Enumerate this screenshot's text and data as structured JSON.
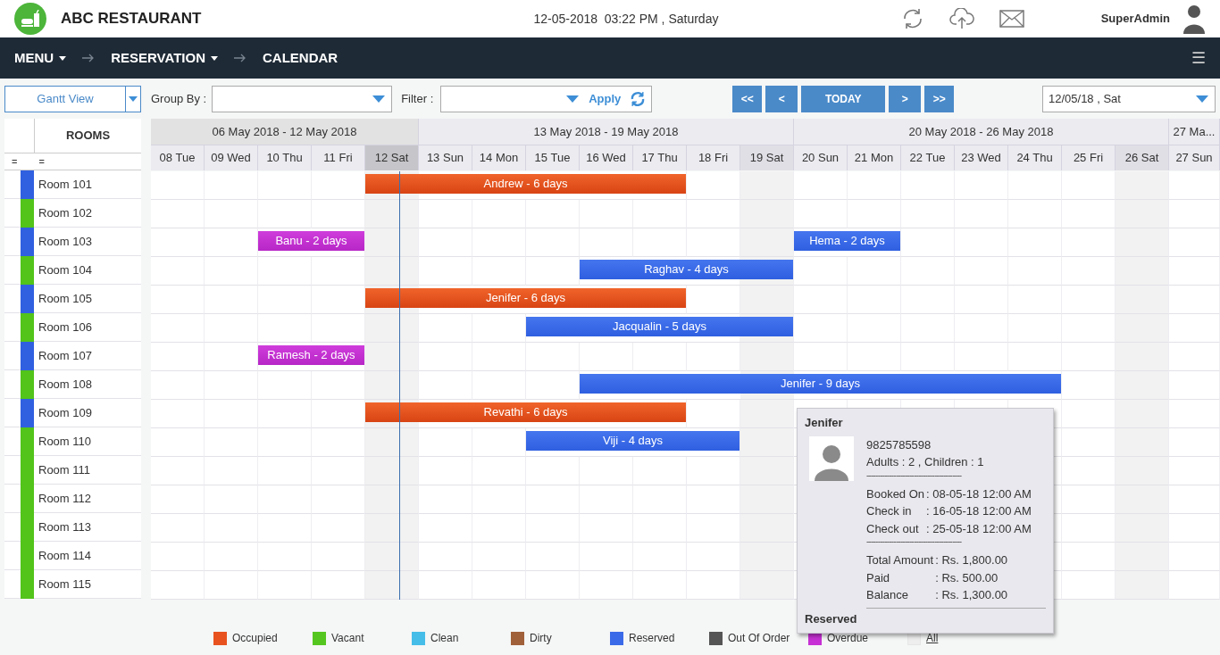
{
  "header": {
    "title": "ABC RESTAURANT",
    "datetime": "12-05-2018  03:22 PM , Saturday",
    "user": "SuperAdmin"
  },
  "breadcrumb": {
    "items": [
      {
        "label": "MENU",
        "dropdown": true
      },
      {
        "label": "RESERVATION",
        "dropdown": true
      },
      {
        "label": "CALENDAR",
        "dropdown": false
      }
    ],
    "menu_glyph": "☰"
  },
  "toolbar": {
    "view": "Gantt View",
    "group_by_label": "Group By :",
    "filter_label": "Filter :",
    "apply": "Apply",
    "nav_buttons": [
      {
        "label": "<<"
      },
      {
        "label": "<"
      },
      {
        "label": "TODAY"
      },
      {
        "label": ">"
      },
      {
        "label": ">>"
      }
    ],
    "date": "12/05/18 , Sat"
  },
  "rooms_header": "ROOMS",
  "handles": [
    "=",
    "="
  ],
  "weeks": [
    {
      "label": "06 May 2018 - 12 May 2018",
      "days": [
        {
          "label": "08 Tue",
          "weekend": false,
          "today": false
        },
        {
          "label": "09 Wed",
          "weekend": false,
          "today": false
        },
        {
          "label": "10 Thu",
          "weekend": false,
          "today": false
        },
        {
          "label": "11 Fri",
          "weekend": false,
          "today": false
        },
        {
          "label": "12 Sat",
          "weekend": true,
          "today": true
        }
      ]
    },
    {
      "label": "13 May 2018 - 19 May 2018",
      "days": [
        {
          "label": "13 Sun",
          "weekend": false,
          "today": false
        },
        {
          "label": "14 Mon",
          "weekend": false,
          "today": false
        },
        {
          "label": "15 Tue",
          "weekend": false,
          "today": false
        },
        {
          "label": "16 Wed",
          "weekend": false,
          "today": false
        },
        {
          "label": "17 Thu",
          "weekend": false,
          "today": false
        },
        {
          "label": "18 Fri",
          "weekend": false,
          "today": false
        },
        {
          "label": "19 Sat",
          "weekend": true,
          "today": false
        }
      ]
    },
    {
      "label": "20 May 2018 - 26 May 2018",
      "days": [
        {
          "label": "20 Sun",
          "weekend": false,
          "today": false
        },
        {
          "label": "21 Mon",
          "weekend": false,
          "today": false
        },
        {
          "label": "22 Tue",
          "weekend": false,
          "today": false
        },
        {
          "label": "23 Wed",
          "weekend": false,
          "today": false
        },
        {
          "label": "24 Thu",
          "weekend": false,
          "today": false
        },
        {
          "label": "25 Fri",
          "weekend": false,
          "today": false
        },
        {
          "label": "26 Sat",
          "weekend": true,
          "today": false
        }
      ]
    },
    {
      "label": "27 Ma...",
      "days": [
        {
          "label": "27 Sun",
          "weekend": false,
          "today": false
        }
      ]
    }
  ],
  "rooms": [
    {
      "name": "Room 101",
      "color": "#3060e0",
      "slots": [
        {
          "kind": "free"
        },
        {
          "kind": "free"
        },
        {
          "kind": "free"
        },
        {
          "kind": "free"
        },
        {
          "kind": "occupied",
          "label": "Andrew - 6 days"
        },
        {
          "kind": "occupied"
        },
        {
          "kind": "occupied"
        },
        {
          "kind": "occupied"
        },
        {
          "kind": "occupied"
        },
        {
          "kind": "occupied"
        },
        {
          "kind": "free"
        },
        {
          "kind": "free"
        },
        {
          "kind": "free"
        },
        {
          "kind": "free"
        },
        {
          "kind": "free"
        },
        {
          "kind": "free"
        },
        {
          "kind": "free"
        },
        {
          "kind": "free"
        },
        {
          "kind": "free"
        },
        {
          "kind": "free"
        }
      ]
    },
    {
      "name": "Room 102",
      "color": "#52c41a",
      "slots": [
        {
          "kind": "free"
        },
        {
          "kind": "free"
        },
        {
          "kind": "free"
        },
        {
          "kind": "free"
        },
        {
          "kind": "free"
        },
        {
          "kind": "free"
        },
        {
          "kind": "free"
        },
        {
          "kind": "free"
        },
        {
          "kind": "free"
        },
        {
          "kind": "free"
        },
        {
          "kind": "free"
        },
        {
          "kind": "free"
        },
        {
          "kind": "free"
        },
        {
          "kind": "free"
        },
        {
          "kind": "free"
        },
        {
          "kind": "free"
        },
        {
          "kind": "free"
        },
        {
          "kind": "free"
        },
        {
          "kind": "free"
        },
        {
          "kind": "free"
        }
      ]
    },
    {
      "name": "Room 103",
      "color": "#3060e0",
      "slots": [
        {
          "kind": "free"
        },
        {
          "kind": "free"
        },
        {
          "kind": "overdue",
          "label": "Banu - 2 days"
        },
        {
          "kind": "overdue"
        },
        {
          "kind": "free"
        },
        {
          "kind": "free"
        },
        {
          "kind": "free"
        },
        {
          "kind": "free"
        },
        {
          "kind": "free"
        },
        {
          "kind": "free"
        },
        {
          "kind": "free"
        },
        {
          "kind": "free"
        },
        {
          "kind": "reserved",
          "label": "Hema - 2 days"
        },
        {
          "kind": "reserved"
        },
        {
          "kind": "free"
        },
        {
          "kind": "free"
        },
        {
          "kind": "free"
        },
        {
          "kind": "free"
        },
        {
          "kind": "free"
        },
        {
          "kind": "free"
        }
      ]
    },
    {
      "name": "Room 104",
      "color": "#52c41a",
      "slots": [
        {
          "kind": "free"
        },
        {
          "kind": "free"
        },
        {
          "kind": "free"
        },
        {
          "kind": "free"
        },
        {
          "kind": "free"
        },
        {
          "kind": "free"
        },
        {
          "kind": "free"
        },
        {
          "kind": "free"
        },
        {
          "kind": "reserved",
          "label": "Raghav - 4 days"
        },
        {
          "kind": "reserved"
        },
        {
          "kind": "reserved"
        },
        {
          "kind": "reserved"
        },
        {
          "kind": "free"
        },
        {
          "kind": "free"
        },
        {
          "kind": "free"
        },
        {
          "kind": "free"
        },
        {
          "kind": "free"
        },
        {
          "kind": "free"
        },
        {
          "kind": "free"
        },
        {
          "kind": "free"
        }
      ]
    },
    {
      "name": "Room 105",
      "color": "#3060e0",
      "slots": [
        {
          "kind": "free"
        },
        {
          "kind": "free"
        },
        {
          "kind": "free"
        },
        {
          "kind": "free"
        },
        {
          "kind": "occupied",
          "label": "Jenifer - 6 days"
        },
        {
          "kind": "occupied"
        },
        {
          "kind": "occupied"
        },
        {
          "kind": "occupied"
        },
        {
          "kind": "occupied"
        },
        {
          "kind": "occupied"
        },
        {
          "kind": "free"
        },
        {
          "kind": "free"
        },
        {
          "kind": "free"
        },
        {
          "kind": "free"
        },
        {
          "kind": "free"
        },
        {
          "kind": "free"
        },
        {
          "kind": "free"
        },
        {
          "kind": "free"
        },
        {
          "kind": "free"
        },
        {
          "kind": "free"
        }
      ]
    },
    {
      "name": "Room 106",
      "color": "#52c41a",
      "slots": [
        {
          "kind": "free"
        },
        {
          "kind": "free"
        },
        {
          "kind": "free"
        },
        {
          "kind": "free"
        },
        {
          "kind": "free"
        },
        {
          "kind": "free"
        },
        {
          "kind": "free"
        },
        {
          "kind": "reserved",
          "label": "Jacqualin - 5 days"
        },
        {
          "kind": "reserved"
        },
        {
          "kind": "reserved"
        },
        {
          "kind": "reserved"
        },
        {
          "kind": "reserved"
        },
        {
          "kind": "free"
        },
        {
          "kind": "free"
        },
        {
          "kind": "free"
        },
        {
          "kind": "free"
        },
        {
          "kind": "free"
        },
        {
          "kind": "free"
        },
        {
          "kind": "free"
        },
        {
          "kind": "free"
        }
      ]
    },
    {
      "name": "Room 107",
      "color": "#3060e0",
      "slots": [
        {
          "kind": "free"
        },
        {
          "kind": "free"
        },
        {
          "kind": "overdue",
          "label": "Ramesh - 2 days"
        },
        {
          "kind": "overdue"
        },
        {
          "kind": "free"
        },
        {
          "kind": "free"
        },
        {
          "kind": "free"
        },
        {
          "kind": "free"
        },
        {
          "kind": "free"
        },
        {
          "kind": "free"
        },
        {
          "kind": "free"
        },
        {
          "kind": "free"
        },
        {
          "kind": "free"
        },
        {
          "kind": "free"
        },
        {
          "kind": "free"
        },
        {
          "kind": "free"
        },
        {
          "kind": "free"
        },
        {
          "kind": "free"
        },
        {
          "kind": "free"
        },
        {
          "kind": "free"
        }
      ]
    },
    {
      "name": "Room 108",
      "color": "#52c41a",
      "slots": [
        {
          "kind": "free"
        },
        {
          "kind": "free"
        },
        {
          "kind": "free"
        },
        {
          "kind": "free"
        },
        {
          "kind": "free"
        },
        {
          "kind": "free"
        },
        {
          "kind": "free"
        },
        {
          "kind": "free"
        },
        {
          "kind": "reserved",
          "label": "Jenifer - 9 days"
        },
        {
          "kind": "reserved"
        },
        {
          "kind": "reserved"
        },
        {
          "kind": "reserved"
        },
        {
          "kind": "reserved"
        },
        {
          "kind": "reserved"
        },
        {
          "kind": "reserved"
        },
        {
          "kind": "reserved"
        },
        {
          "kind": "reserved"
        },
        {
          "kind": "free"
        },
        {
          "kind": "free"
        },
        {
          "kind": "free"
        }
      ]
    },
    {
      "name": "Room 109",
      "color": "#3060e0",
      "slots": [
        {
          "kind": "free"
        },
        {
          "kind": "free"
        },
        {
          "kind": "free"
        },
        {
          "kind": "free"
        },
        {
          "kind": "occupied",
          "label": "Revathi - 6 days"
        },
        {
          "kind": "occupied"
        },
        {
          "kind": "occupied"
        },
        {
          "kind": "occupied"
        },
        {
          "kind": "occupied"
        },
        {
          "kind": "occupied"
        },
        {
          "kind": "free"
        },
        {
          "kind": "free"
        },
        {
          "kind": "free"
        },
        {
          "kind": "free"
        },
        {
          "kind": "free"
        },
        {
          "kind": "free"
        },
        {
          "kind": "free"
        },
        {
          "kind": "free"
        },
        {
          "kind": "free"
        },
        {
          "kind": "free"
        }
      ]
    },
    {
      "name": "Room 110",
      "color": "#52c41a",
      "slots": [
        {
          "kind": "free"
        },
        {
          "kind": "free"
        },
        {
          "kind": "free"
        },
        {
          "kind": "free"
        },
        {
          "kind": "free"
        },
        {
          "kind": "free"
        },
        {
          "kind": "free"
        },
        {
          "kind": "reserved",
          "label": "Viji - 4 days"
        },
        {
          "kind": "reserved"
        },
        {
          "kind": "reserved"
        },
        {
          "kind": "reserved"
        },
        {
          "kind": "free"
        },
        {
          "kind": "free"
        },
        {
          "kind": "free"
        },
        {
          "kind": "free"
        },
        {
          "kind": "free"
        },
        {
          "kind": "free"
        },
        {
          "kind": "free"
        },
        {
          "kind": "free"
        },
        {
          "kind": "free"
        }
      ]
    },
    {
      "name": "Room 111",
      "color": "#52c41a",
      "slots": [
        {
          "kind": "free"
        },
        {
          "kind": "free"
        },
        {
          "kind": "free"
        },
        {
          "kind": "free"
        },
        {
          "kind": "free"
        },
        {
          "kind": "free"
        },
        {
          "kind": "free"
        },
        {
          "kind": "free"
        },
        {
          "kind": "free"
        },
        {
          "kind": "free"
        },
        {
          "kind": "free"
        },
        {
          "kind": "free"
        },
        {
          "kind": "free"
        },
        {
          "kind": "free"
        },
        {
          "kind": "free"
        },
        {
          "kind": "free"
        },
        {
          "kind": "free"
        },
        {
          "kind": "free"
        },
        {
          "kind": "free"
        },
        {
          "kind": "free"
        }
      ]
    },
    {
      "name": "Room 112",
      "color": "#52c41a",
      "slots": [
        {
          "kind": "free"
        },
        {
          "kind": "free"
        },
        {
          "kind": "free"
        },
        {
          "kind": "free"
        },
        {
          "kind": "free"
        },
        {
          "kind": "free"
        },
        {
          "kind": "free"
        },
        {
          "kind": "free"
        },
        {
          "kind": "free"
        },
        {
          "kind": "free"
        },
        {
          "kind": "free"
        },
        {
          "kind": "free"
        },
        {
          "kind": "free"
        },
        {
          "kind": "free"
        },
        {
          "kind": "free"
        },
        {
          "kind": "free"
        },
        {
          "kind": "free"
        },
        {
          "kind": "free"
        },
        {
          "kind": "free"
        },
        {
          "kind": "free"
        }
      ]
    },
    {
      "name": "Room 113",
      "color": "#52c41a",
      "slots": [
        {
          "kind": "free"
        },
        {
          "kind": "free"
        },
        {
          "kind": "free"
        },
        {
          "kind": "free"
        },
        {
          "kind": "free"
        },
        {
          "kind": "free"
        },
        {
          "kind": "free"
        },
        {
          "kind": "free"
        },
        {
          "kind": "free"
        },
        {
          "kind": "free"
        },
        {
          "kind": "free"
        },
        {
          "kind": "free"
        },
        {
          "kind": "free"
        },
        {
          "kind": "free"
        },
        {
          "kind": "free"
        },
        {
          "kind": "free"
        },
        {
          "kind": "free"
        },
        {
          "kind": "free"
        },
        {
          "kind": "free"
        },
        {
          "kind": "free"
        }
      ]
    },
    {
      "name": "Room 114",
      "color": "#52c41a",
      "slots": [
        {
          "kind": "free"
        },
        {
          "kind": "free"
        },
        {
          "kind": "free"
        },
        {
          "kind": "free"
        },
        {
          "kind": "free"
        },
        {
          "kind": "free"
        },
        {
          "kind": "free"
        },
        {
          "kind": "free"
        },
        {
          "kind": "free"
        },
        {
          "kind": "free"
        },
        {
          "kind": "free"
        },
        {
          "kind": "free"
        },
        {
          "kind": "free"
        },
        {
          "kind": "free"
        },
        {
          "kind": "free"
        },
        {
          "kind": "free"
        },
        {
          "kind": "free"
        },
        {
          "kind": "free"
        },
        {
          "kind": "free"
        },
        {
          "kind": "free"
        }
      ]
    },
    {
      "name": "Room 115",
      "color": "#52c41a",
      "slots": [
        {
          "kind": "free"
        },
        {
          "kind": "free"
        },
        {
          "kind": "free"
        },
        {
          "kind": "free"
        },
        {
          "kind": "free"
        },
        {
          "kind": "free"
        },
        {
          "kind": "free"
        },
        {
          "kind": "free"
        },
        {
          "kind": "free"
        },
        {
          "kind": "free"
        },
        {
          "kind": "free"
        },
        {
          "kind": "free"
        },
        {
          "kind": "free"
        },
        {
          "kind": "free"
        },
        {
          "kind": "free"
        },
        {
          "kind": "free"
        },
        {
          "kind": "free"
        },
        {
          "kind": "free"
        },
        {
          "kind": "free"
        },
        {
          "kind": "free"
        }
      ]
    }
  ],
  "tooltip": {
    "name": "Jenifer",
    "phone": "9825785598",
    "guests": "Adults : 2 , Children : 1",
    "divider": "------------------------------------------",
    "dates": [
      {
        "label": "Booked On ",
        "value": ": 08-05-18 12:00 AM"
      },
      {
        "label": "Check in",
        "value": ": 16-05-18 12:00 AM"
      },
      {
        "label": "Check out",
        "value": ": 25-05-18 12:00 AM"
      }
    ],
    "divider2": "------------------------------------------",
    "amounts": [
      {
        "label": "Total Amount ",
        "value": ": Rs. 1,800.00"
      },
      {
        "label": "Paid",
        "value": ": Rs. 500.00"
      },
      {
        "label": "Balance",
        "value": ": Rs. 1,300.00"
      }
    ],
    "status": "Reserved"
  },
  "legend": [
    {
      "label": "Occupied",
      "color": "#e8521f",
      "kind": "swatch"
    },
    {
      "label": "Vacant",
      "color": "#55c620",
      "kind": "swatch"
    },
    {
      "label": "Clean",
      "color": "#46bde8",
      "kind": "swatch"
    },
    {
      "label": "Dirty",
      "color": "#a0603a",
      "kind": "swatch"
    },
    {
      "label": "Reserved",
      "color": "#3a6ae8",
      "kind": "swatch"
    },
    {
      "label": "Out Of Order",
      "color": "#555555",
      "kind": "swatch"
    },
    {
      "label": "Overdue",
      "color": "#c630d4",
      "kind": "swatch"
    },
    {
      "label": "All",
      "color": "#eeeeee",
      "kind": "link"
    }
  ]
}
